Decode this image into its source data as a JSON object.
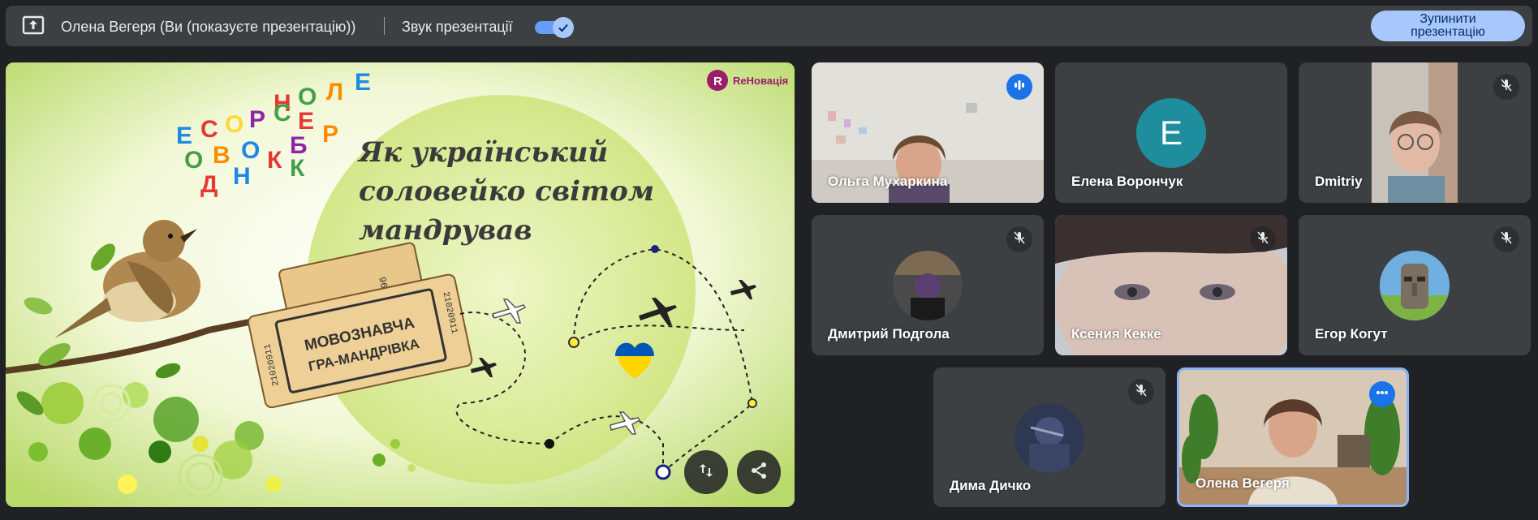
{
  "topbar": {
    "presenter_label": "Олена Вегеря (Ви (показуєте презентацію))",
    "sound_label": "Звук презентації",
    "sound_on": true,
    "stop_line1": "Зупинити",
    "stop_line2": "презентацію"
  },
  "slide": {
    "brand": "ReНовація",
    "title_line1": "Як український",
    "title_line2": "соловейко світом",
    "title_line3": "мандрував",
    "ticket_line1": "МОВОЗНАВЧА",
    "ticket_line2": "ГРА-МАНДРІВКА",
    "ticket_serial": "21020911",
    "ticket_serial2": "96",
    "letters_row1": [
      "Н",
      "О",
      "Л",
      "Е"
    ],
    "letters_row2": [
      "Е",
      "С",
      "О",
      "Р",
      "С",
      "Е",
      "Р"
    ],
    "letters_row3": [
      "О",
      "В",
      "О",
      "К",
      "Б"
    ],
    "letters_row4": [
      "Д",
      "Н",
      "К"
    ]
  },
  "participants": [
    {
      "name": "Ольга Мухаркина",
      "status": "speaking"
    },
    {
      "name": "Елена Ворончук",
      "status": "none",
      "initial": "Е",
      "avatar_color": "#1e8e9e"
    },
    {
      "name": "Dmitriy",
      "status": "muted"
    },
    {
      "name": "Дмитрий Подгола",
      "status": "muted"
    },
    {
      "name": "Ксения Кекке",
      "status": "muted"
    },
    {
      "name": "Егор Когут",
      "status": "muted"
    },
    {
      "name": "Дима Дичко",
      "status": "muted"
    },
    {
      "name": "Олена Вегеря",
      "status": "more"
    }
  ],
  "colors": {
    "accent": "#8ab4f8",
    "speaking": "#1a73e8",
    "tile_bg": "#3c4043",
    "page_bg": "#202124"
  },
  "icons": {
    "present": "present-to-all-icon",
    "toggle_check": "check-icon",
    "swap": "swap-vert-icon",
    "share": "share-icon",
    "mute": "mic-off-icon",
    "speaking": "audio-bars-icon",
    "more": "more-dots-icon"
  }
}
